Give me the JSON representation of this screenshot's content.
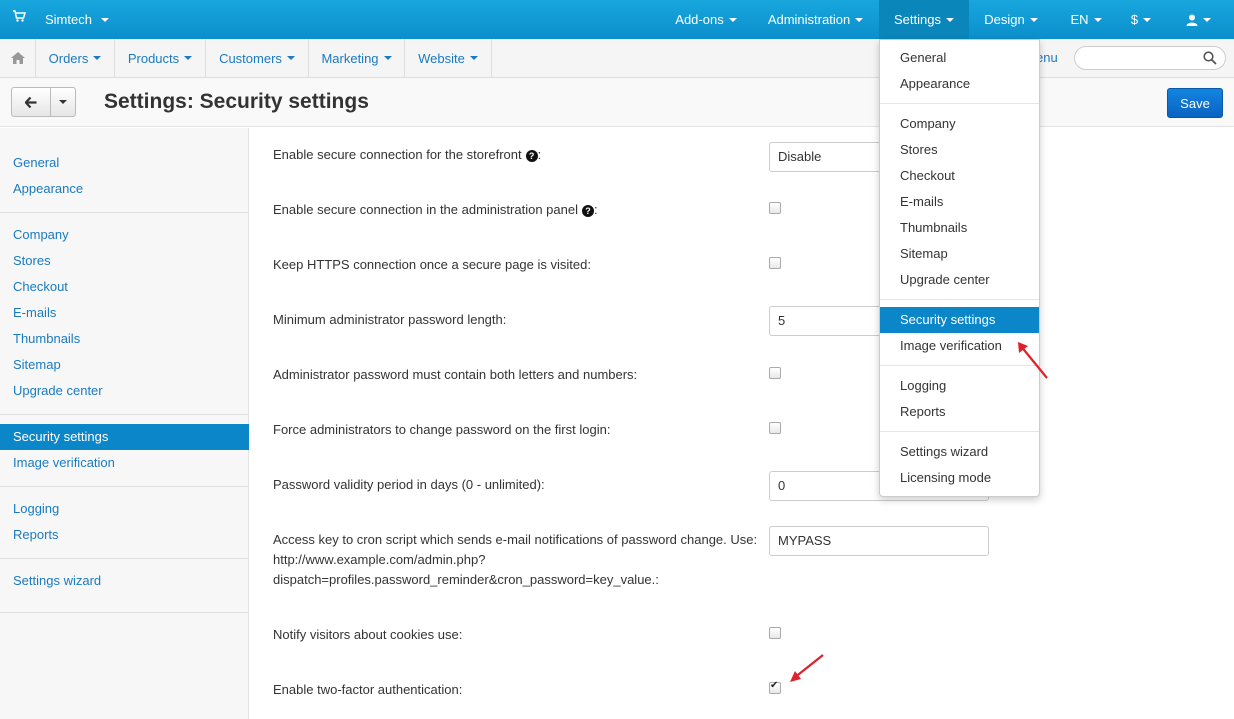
{
  "topbar": {
    "brand": "Simtech",
    "menus": [
      "Add-ons",
      "Administration",
      "Settings",
      "Design",
      "EN",
      "$"
    ],
    "user_icon": "user-icon",
    "cart_icon": "cart-icon"
  },
  "secbar": {
    "home_icon": "home-icon",
    "items": [
      "Orders",
      "Products",
      "Customers",
      "Marketing",
      "Website"
    ],
    "menu_link": "enu",
    "search_placeholder": ""
  },
  "title": {
    "text": "Settings: Security settings",
    "save_label": "Save"
  },
  "sidebar": {
    "items": [
      "General",
      "Appearance",
      "Company",
      "Stores",
      "Checkout",
      "E-mails",
      "Thumbnails",
      "Sitemap",
      "Upgrade center",
      "Security settings",
      "Image verification",
      "Logging",
      "Reports",
      "Settings wizard"
    ],
    "active": "Security settings"
  },
  "form": {
    "rows": [
      {
        "label": "Enable secure connection for the storefront",
        "help": true,
        "type": "select",
        "value": "Disable"
      },
      {
        "label": "Enable secure connection in the administration panel",
        "help": true,
        "type": "checkbox",
        "checked": false
      },
      {
        "label": "Keep HTTPS connection once a secure page is visited:",
        "type": "checkbox",
        "checked": false
      },
      {
        "label": "Minimum administrator password length:",
        "type": "input",
        "value": "5"
      },
      {
        "label": "Administrator password must contain both letters and numbers:",
        "type": "checkbox",
        "checked": false
      },
      {
        "label": "Force administrators to change password on the first login:",
        "type": "checkbox",
        "checked": false
      },
      {
        "label": "Password validity period in days (0 - unlimited):",
        "type": "input",
        "value": "0"
      },
      {
        "label_lines": [
          "Access key to cron script which sends e-mail notifications of password change. Use:",
          "http://www.example.com/admin.php?",
          "dispatch=profiles.password_reminder&cron_password=key_value.:"
        ],
        "type": "input",
        "value": "MYPASS"
      },
      {
        "label": "Notify visitors about cookies use:",
        "type": "checkbox",
        "checked": false
      },
      {
        "label": "Enable two-factor authentication:",
        "type": "checkbox",
        "checked": true
      }
    ]
  },
  "dropdown": {
    "items": [
      "General",
      "Appearance",
      "Company",
      "Stores",
      "Checkout",
      "E-mails",
      "Thumbnails",
      "Sitemap",
      "Upgrade center",
      "Security settings",
      "Image verification",
      "Logging",
      "Reports",
      "Settings wizard",
      "Licensing mode"
    ],
    "active": "Security settings"
  },
  "colors": {
    "topbar": "#0b9bd6",
    "accent": "#0b86c9",
    "link": "#1b7ac0",
    "save": "#0a63c1",
    "annotation_arrow": "#e0202a"
  }
}
